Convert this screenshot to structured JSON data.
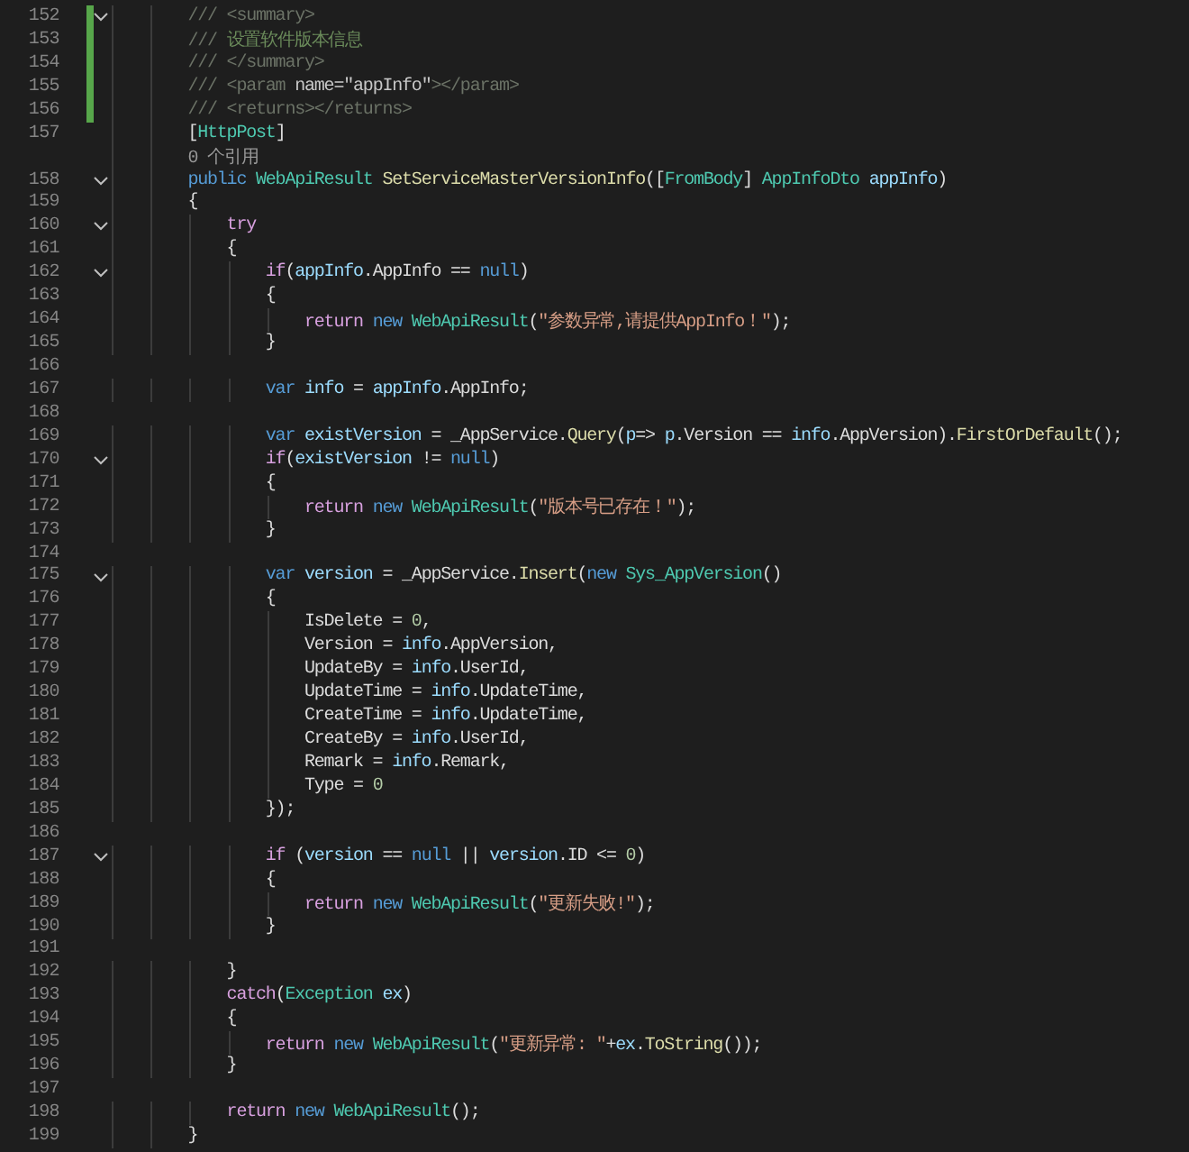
{
  "lines": [
    {
      "number": "152",
      "fold": true,
      "changed": true,
      "tokens": [
        {
          "kind": "doc",
          "text": "        /// <summary>"
        }
      ]
    },
    {
      "number": "153",
      "fold": false,
      "changed": true,
      "tokens": [
        {
          "kind": "doc",
          "text": "        /// "
        },
        {
          "kind": "comment",
          "text": "设置软件版本信息"
        }
      ]
    },
    {
      "number": "154",
      "fold": false,
      "changed": true,
      "tokens": [
        {
          "kind": "doc",
          "text": "        /// </summary>"
        }
      ]
    },
    {
      "number": "155",
      "fold": false,
      "changed": true,
      "tokens": [
        {
          "kind": "doc",
          "text": "        /// <param "
        },
        {
          "kind": "docattr",
          "text": "name=\"appInfo\""
        },
        {
          "kind": "doc",
          "text": "></param>"
        }
      ]
    },
    {
      "number": "156",
      "fold": false,
      "changed": true,
      "tokens": [
        {
          "kind": "doc",
          "text": "        /// <returns></returns>"
        }
      ]
    },
    {
      "number": "157",
      "fold": false,
      "changed": false,
      "tokens": [
        {
          "kind": "plain",
          "text": "        ["
        },
        {
          "kind": "type",
          "text": "HttpPost"
        },
        {
          "kind": "plain",
          "text": "]"
        }
      ]
    },
    {
      "kind": "codelens",
      "text": "        0 个引用"
    },
    {
      "number": "158",
      "fold": true,
      "changed": false,
      "tokens": [
        {
          "kind": "keyword",
          "text": "        public "
        },
        {
          "kind": "type",
          "text": "WebApiResult "
        },
        {
          "kind": "method",
          "text": "SetServiceMasterVersionInfo"
        },
        {
          "kind": "plain",
          "text": "(["
        },
        {
          "kind": "type",
          "text": "FromBody"
        },
        {
          "kind": "plain",
          "text": "] "
        },
        {
          "kind": "type",
          "text": "AppInfoDto "
        },
        {
          "kind": "var",
          "text": "appInfo"
        },
        {
          "kind": "plain",
          "text": ")"
        }
      ]
    },
    {
      "number": "159",
      "fold": false,
      "changed": false,
      "tokens": [
        {
          "kind": "plain",
          "text": "        {"
        }
      ]
    },
    {
      "number": "160",
      "fold": true,
      "changed": false,
      "tokens": [
        {
          "kind": "control",
          "text": "            try"
        }
      ]
    },
    {
      "number": "161",
      "fold": false,
      "changed": false,
      "tokens": [
        {
          "kind": "plain",
          "text": "            {"
        }
      ]
    },
    {
      "number": "162",
      "fold": true,
      "changed": false,
      "tokens": [
        {
          "kind": "control",
          "text": "                if"
        },
        {
          "kind": "plain",
          "text": "("
        },
        {
          "kind": "var",
          "text": "appInfo"
        },
        {
          "kind": "plain",
          "text": ".AppInfo == "
        },
        {
          "kind": "keyword",
          "text": "null"
        },
        {
          "kind": "plain",
          "text": ")"
        }
      ]
    },
    {
      "number": "163",
      "fold": false,
      "changed": false,
      "tokens": [
        {
          "kind": "plain",
          "text": "                {"
        }
      ]
    },
    {
      "number": "164",
      "fold": false,
      "changed": false,
      "tokens": [
        {
          "kind": "control",
          "text": "                    return "
        },
        {
          "kind": "keyword",
          "text": "new "
        },
        {
          "kind": "type",
          "text": "WebApiResult"
        },
        {
          "kind": "plain",
          "text": "("
        },
        {
          "kind": "string",
          "text": "\"参数异常,请提供AppInfo！\""
        },
        {
          "kind": "plain",
          "text": ");"
        }
      ]
    },
    {
      "number": "165",
      "fold": false,
      "changed": false,
      "tokens": [
        {
          "kind": "plain",
          "text": "                }"
        }
      ]
    },
    {
      "number": "166",
      "fold": false,
      "changed": false
    },
    {
      "number": "167",
      "fold": false,
      "changed": false,
      "tokens": [
        {
          "kind": "keyword",
          "text": "                var "
        },
        {
          "kind": "var",
          "text": "info"
        },
        {
          "kind": "plain",
          "text": " = "
        },
        {
          "kind": "var",
          "text": "appInfo"
        },
        {
          "kind": "plain",
          "text": ".AppInfo;"
        }
      ]
    },
    {
      "number": "168",
      "fold": false,
      "changed": false
    },
    {
      "number": "169",
      "fold": false,
      "changed": false,
      "tokens": [
        {
          "kind": "keyword",
          "text": "                var "
        },
        {
          "kind": "var",
          "text": "existVersion"
        },
        {
          "kind": "plain",
          "text": " = _AppService."
        },
        {
          "kind": "method",
          "text": "Query"
        },
        {
          "kind": "plain",
          "text": "("
        },
        {
          "kind": "var",
          "text": "p"
        },
        {
          "kind": "plain",
          "text": "=> "
        },
        {
          "kind": "var",
          "text": "p"
        },
        {
          "kind": "plain",
          "text": ".Version == "
        },
        {
          "kind": "var",
          "text": "info"
        },
        {
          "kind": "plain",
          "text": ".AppVersion)."
        },
        {
          "kind": "method",
          "text": "FirstOrDefault"
        },
        {
          "kind": "plain",
          "text": "();"
        }
      ]
    },
    {
      "number": "170",
      "fold": true,
      "changed": false,
      "tokens": [
        {
          "kind": "control",
          "text": "                if"
        },
        {
          "kind": "plain",
          "text": "("
        },
        {
          "kind": "var",
          "text": "existVersion"
        },
        {
          "kind": "plain",
          "text": " != "
        },
        {
          "kind": "keyword",
          "text": "null"
        },
        {
          "kind": "plain",
          "text": ")"
        }
      ]
    },
    {
      "number": "171",
      "fold": false,
      "changed": false,
      "tokens": [
        {
          "kind": "plain",
          "text": "                {"
        }
      ]
    },
    {
      "number": "172",
      "fold": false,
      "changed": false,
      "tokens": [
        {
          "kind": "control",
          "text": "                    return "
        },
        {
          "kind": "keyword",
          "text": "new "
        },
        {
          "kind": "type",
          "text": "WebApiResult"
        },
        {
          "kind": "plain",
          "text": "("
        },
        {
          "kind": "string",
          "text": "\"版本号已存在！\""
        },
        {
          "kind": "plain",
          "text": ");"
        }
      ]
    },
    {
      "number": "173",
      "fold": false,
      "changed": false,
      "tokens": [
        {
          "kind": "plain",
          "text": "                }"
        }
      ]
    },
    {
      "number": "174",
      "fold": false,
      "changed": false
    },
    {
      "number": "175",
      "fold": true,
      "changed": false,
      "tokens": [
        {
          "kind": "keyword",
          "text": "                var "
        },
        {
          "kind": "var",
          "text": "version"
        },
        {
          "kind": "plain",
          "text": " = _AppService."
        },
        {
          "kind": "method",
          "text": "Insert"
        },
        {
          "kind": "plain",
          "text": "("
        },
        {
          "kind": "keyword",
          "text": "new "
        },
        {
          "kind": "type",
          "text": "Sys_AppVersion"
        },
        {
          "kind": "plain",
          "text": "()"
        }
      ]
    },
    {
      "number": "176",
      "fold": false,
      "changed": false,
      "tokens": [
        {
          "kind": "plain",
          "text": "                {"
        }
      ]
    },
    {
      "number": "177",
      "fold": false,
      "changed": false,
      "tokens": [
        {
          "kind": "plain",
          "text": "                    IsDelete = "
        },
        {
          "kind": "number",
          "text": "0"
        },
        {
          "kind": "plain",
          "text": ","
        }
      ]
    },
    {
      "number": "178",
      "fold": false,
      "changed": false,
      "tokens": [
        {
          "kind": "plain",
          "text": "                    Version = "
        },
        {
          "kind": "var",
          "text": "info"
        },
        {
          "kind": "plain",
          "text": ".AppVersion,"
        }
      ]
    },
    {
      "number": "179",
      "fold": false,
      "changed": false,
      "tokens": [
        {
          "kind": "plain",
          "text": "                    UpdateBy = "
        },
        {
          "kind": "var",
          "text": "info"
        },
        {
          "kind": "plain",
          "text": ".UserId,"
        }
      ]
    },
    {
      "number": "180",
      "fold": false,
      "changed": false,
      "tokens": [
        {
          "kind": "plain",
          "text": "                    UpdateTime = "
        },
        {
          "kind": "var",
          "text": "info"
        },
        {
          "kind": "plain",
          "text": ".UpdateTime,"
        }
      ]
    },
    {
      "number": "181",
      "fold": false,
      "changed": false,
      "tokens": [
        {
          "kind": "plain",
          "text": "                    CreateTime = "
        },
        {
          "kind": "var",
          "text": "info"
        },
        {
          "kind": "plain",
          "text": ".UpdateTime,"
        }
      ]
    },
    {
      "number": "182",
      "fold": false,
      "changed": false,
      "tokens": [
        {
          "kind": "plain",
          "text": "                    CreateBy = "
        },
        {
          "kind": "var",
          "text": "info"
        },
        {
          "kind": "plain",
          "text": ".UserId,"
        }
      ]
    },
    {
      "number": "183",
      "fold": false,
      "changed": false,
      "tokens": [
        {
          "kind": "plain",
          "text": "                    Remark = "
        },
        {
          "kind": "var",
          "text": "info"
        },
        {
          "kind": "plain",
          "text": ".Remark,"
        }
      ]
    },
    {
      "number": "184",
      "fold": false,
      "changed": false,
      "tokens": [
        {
          "kind": "plain",
          "text": "                    Type = "
        },
        {
          "kind": "number",
          "text": "0"
        }
      ]
    },
    {
      "number": "185",
      "fold": false,
      "changed": false,
      "tokens": [
        {
          "kind": "plain",
          "text": "                });"
        }
      ]
    },
    {
      "number": "186",
      "fold": false,
      "changed": false
    },
    {
      "number": "187",
      "fold": true,
      "changed": false,
      "tokens": [
        {
          "kind": "control",
          "text": "                if "
        },
        {
          "kind": "plain",
          "text": "("
        },
        {
          "kind": "var",
          "text": "version"
        },
        {
          "kind": "plain",
          "text": " == "
        },
        {
          "kind": "keyword",
          "text": "null"
        },
        {
          "kind": "plain",
          "text": " || "
        },
        {
          "kind": "var",
          "text": "version"
        },
        {
          "kind": "plain",
          "text": ".ID <= "
        },
        {
          "kind": "number",
          "text": "0"
        },
        {
          "kind": "plain",
          "text": ")"
        }
      ]
    },
    {
      "number": "188",
      "fold": false,
      "changed": false,
      "tokens": [
        {
          "kind": "plain",
          "text": "                {"
        }
      ]
    },
    {
      "number": "189",
      "fold": false,
      "changed": false,
      "tokens": [
        {
          "kind": "control",
          "text": "                    return "
        },
        {
          "kind": "keyword",
          "text": "new "
        },
        {
          "kind": "type",
          "text": "WebApiResult"
        },
        {
          "kind": "plain",
          "text": "("
        },
        {
          "kind": "string",
          "text": "\"更新失败!\""
        },
        {
          "kind": "plain",
          "text": ");"
        }
      ]
    },
    {
      "number": "190",
      "fold": false,
      "changed": false,
      "tokens": [
        {
          "kind": "plain",
          "text": "                }"
        }
      ]
    },
    {
      "number": "191",
      "fold": false,
      "changed": false
    },
    {
      "number": "192",
      "fold": false,
      "changed": false,
      "tokens": [
        {
          "kind": "plain",
          "text": "            }"
        }
      ]
    },
    {
      "number": "193",
      "fold": false,
      "changed": false,
      "tokens": [
        {
          "kind": "control",
          "text": "            catch"
        },
        {
          "kind": "plain",
          "text": "("
        },
        {
          "kind": "type",
          "text": "Exception "
        },
        {
          "kind": "var",
          "text": "ex"
        },
        {
          "kind": "plain",
          "text": ")"
        }
      ]
    },
    {
      "number": "194",
      "fold": false,
      "changed": false,
      "tokens": [
        {
          "kind": "plain",
          "text": "            {"
        }
      ]
    },
    {
      "number": "195",
      "fold": false,
      "changed": false,
      "tokens": [
        {
          "kind": "control",
          "text": "                return "
        },
        {
          "kind": "keyword",
          "text": "new "
        },
        {
          "kind": "type",
          "text": "WebApiResult"
        },
        {
          "kind": "plain",
          "text": "("
        },
        {
          "kind": "string",
          "text": "\"更新异常: \""
        },
        {
          "kind": "plain",
          "text": "+"
        },
        {
          "kind": "var",
          "text": "ex"
        },
        {
          "kind": "plain",
          "text": "."
        },
        {
          "kind": "method",
          "text": "ToString"
        },
        {
          "kind": "plain",
          "text": "());"
        }
      ]
    },
    {
      "number": "196",
      "fold": false,
      "changed": false,
      "tokens": [
        {
          "kind": "plain",
          "text": "            }"
        }
      ]
    },
    {
      "number": "197",
      "fold": false,
      "changed": false
    },
    {
      "number": "198",
      "fold": false,
      "changed": false,
      "tokens": [
        {
          "kind": "control",
          "text": "            return "
        },
        {
          "kind": "keyword",
          "text": "new "
        },
        {
          "kind": "type",
          "text": "WebApiResult"
        },
        {
          "kind": "plain",
          "text": "();"
        }
      ]
    },
    {
      "number": "199",
      "fold": false,
      "changed": false,
      "tokens": [
        {
          "kind": "plain",
          "text": "        }"
        }
      ]
    }
  ]
}
